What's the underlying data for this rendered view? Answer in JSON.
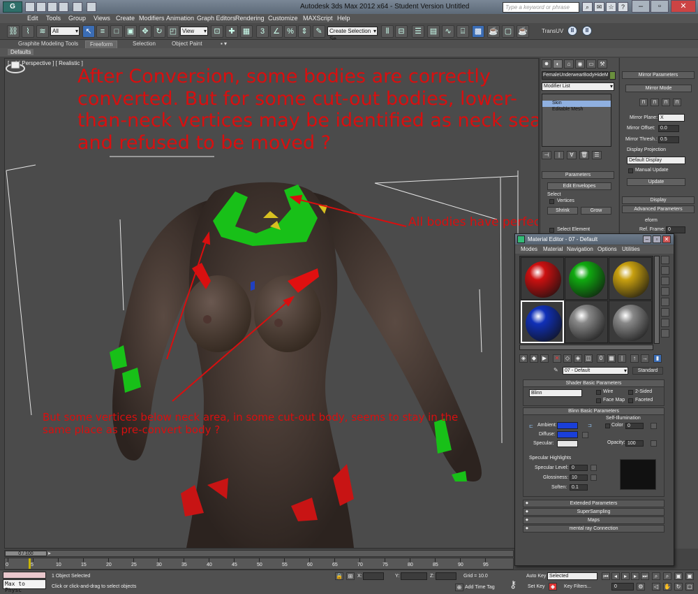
{
  "titlebar": {
    "title": "Autodesk 3ds Max 2012 x64  -  Student Version     Untitled",
    "search_placeholder": "Type a keyword or phrase",
    "app_icon": "3ds-max-logo"
  },
  "menubar": {
    "items": [
      "Edit",
      "Tools",
      "Group",
      "Views",
      "Create",
      "Modifiers",
      "Animation",
      "Graph Editors",
      "Rendering",
      "Customize",
      "MAXScript",
      "Help"
    ]
  },
  "toolbar": {
    "selection_filter": "All",
    "reference_coord": "View",
    "named_selection": "Create Selection Se",
    "transuv_label": "TransUV"
  },
  "ribbon": {
    "tabs": [
      "Graphite Modeling Tools",
      "Freeform",
      "Selection",
      "Object Paint"
    ],
    "active_tab": "Freeform",
    "defaults_label": "Defaults"
  },
  "viewport": {
    "label": "[ + ] [ Perspective ] [ Realistic ]",
    "annotation_main": "After Conversion, some bodies are correctly converted. But for some cut-out bodies, lower-than-neck vertices may be identified as neck seam and refused to be moved ?",
    "annotation_seam": "All bodies have perfect neck seam",
    "annotation_bottom": "But some vertices below neck area, in some cut-out body, seems to stay in the same place as pre-convert body ?"
  },
  "command_panel": {
    "object_name": "FemaleUnderwearBodyHideM",
    "modifier_list": "Modifier List",
    "stack": [
      "Skin",
      "Editable Mesh"
    ],
    "parameters_title": "Parameters",
    "edit_envelopes": "Edit Envelopes",
    "select_label": "Select",
    "vertices_label": "Vertices",
    "shrink": "Shrink",
    "grow": "Grow",
    "select_element": "Select Element"
  },
  "mirror_panel": {
    "title": "Mirror Parameters",
    "mirror_mode": "Mirror Mode",
    "mirror_plane_label": "Mirror Plane:",
    "mirror_plane_value": "X",
    "mirror_offset_label": "Mirror Offset:",
    "mirror_offset_value": "0.0",
    "mirror_thresh_label": "Mirror Thresh.:",
    "mirror_thresh_value": "0.5",
    "display_projection_label": "Display Projection",
    "display_projection_value": "Default Display",
    "manual_update": "Manual Update",
    "update": "Update",
    "display": "Display",
    "advanced_parameters": "Advanced Parameters",
    "deform_label": "eform",
    "ref_frame_label": "Ref. Frame:",
    "ref_frame_value": "0"
  },
  "material_editor": {
    "title": "Material Editor - 07 - Default",
    "menu": [
      "Modes",
      "Material",
      "Navigation",
      "Options",
      "Utilities"
    ],
    "slots": [
      "#cc1010",
      "#10aa10",
      "#c8a010",
      "#1030b8",
      "#888888",
      "#888888"
    ],
    "material_name": "07 - Default",
    "material_type": "Standard",
    "shader_basic_title": "Shader Basic Parameters",
    "shader": "Blinn",
    "wire": "Wire",
    "two_sided": "2-Sided",
    "face_map": "Face Map",
    "faceted": "Faceted",
    "blinn_basic_title": "Blinn Basic Parameters",
    "self_illumination": "Self-Illumination",
    "color_label": "Color",
    "color_value": "0",
    "ambient_label": "Ambient:",
    "diffuse_label": "Diffuse:",
    "specular_label": "Specular:",
    "opacity_label": "Opacity:",
    "opacity_value": "100",
    "specular_highlights_title": "Specular Highlights",
    "specular_level_label": "Specular Level:",
    "specular_level_value": "0",
    "glossiness_label": "Glossiness:",
    "glossiness_value": "10",
    "soften_label": "Soften:",
    "soften_value": "0.1",
    "collapsed_rollouts": [
      "Extended Parameters",
      "SuperSampling",
      "Maps",
      "mental ray Connection"
    ],
    "ambient_color": "#1a3fd8",
    "diffuse_color": "#1a3fd8",
    "specular_color": "#e6e6e6"
  },
  "timeline": {
    "slider_label": "0 / 100",
    "ticks": [
      "0",
      "5",
      "10",
      "15",
      "20",
      "25",
      "30",
      "35",
      "40",
      "45",
      "50",
      "55",
      "60",
      "65",
      "70",
      "75",
      "80",
      "85",
      "90",
      "95"
    ]
  },
  "status": {
    "maxscript_text": "Max to Physc",
    "selection_status": "1 Object Selected",
    "prompt": "Click or click-and-drag to select objects",
    "x_label": "X:",
    "y_label": "Y:",
    "z_label": "Z:",
    "grid": "Grid = 10.0",
    "add_time_tag": "Add Time Tag",
    "auto_key": "Auto Key",
    "set_key": "Set Key",
    "selected_mode": "Selected",
    "key_filters": "Key Filters...",
    "frame_value": "0"
  }
}
